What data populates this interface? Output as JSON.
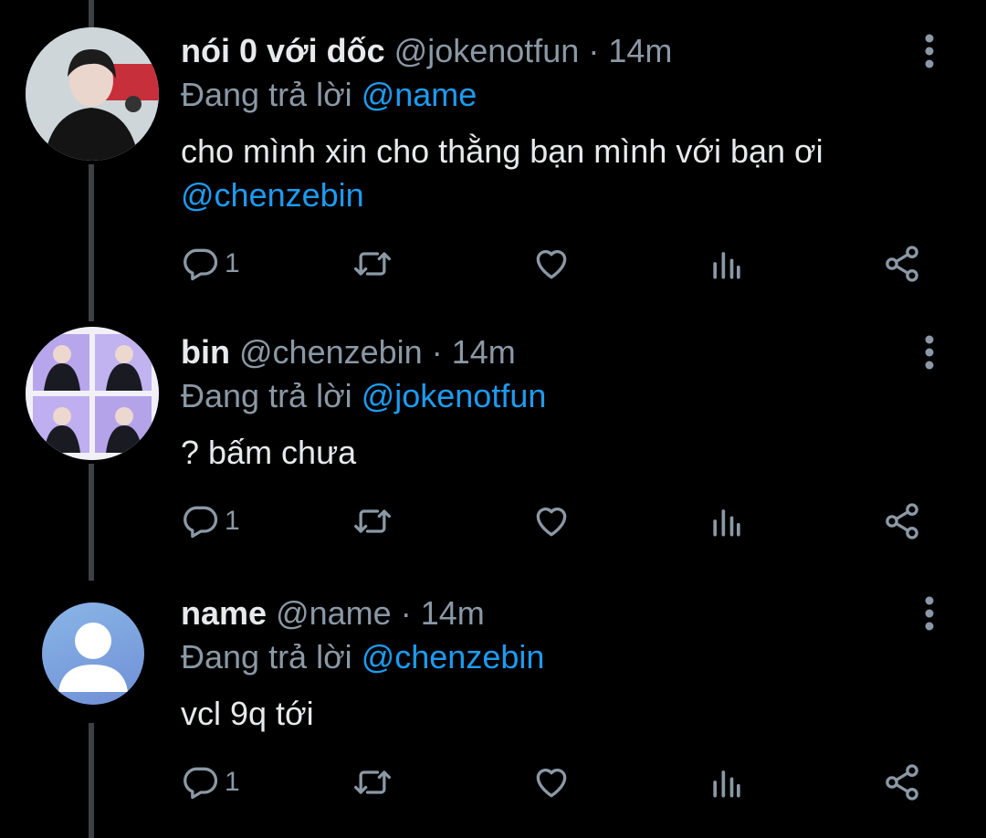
{
  "tweets": [
    {
      "display_name": "nói 0 với dốc",
      "handle": "@jokenotfun",
      "separator": "·",
      "time": "14m",
      "reply_label": "Đang trả lời",
      "reply_to": "@name",
      "text_line1": "cho mình xin cho thằng bạn mình với bạn ơi",
      "text_mention": "@chenzebin",
      "reply_count": "1",
      "avatar": "photo-avatar"
    },
    {
      "display_name": "bin",
      "handle": "@chenzebin",
      "separator": "·",
      "time": "14m",
      "reply_label": "Đang trả lời",
      "reply_to": "@jokenotfun",
      "text_line1": "? bấm chưa",
      "reply_count": "1",
      "avatar": "photo-grid-avatar"
    },
    {
      "display_name": "name",
      "handle": "@name",
      "separator": "·",
      "time": "14m",
      "reply_label": "Đang trả lời",
      "reply_to": "@chenzebin",
      "text_line1": "vcl 9q tới",
      "reply_count": "1",
      "avatar": "default-avatar"
    }
  ],
  "icons": {
    "more": "more-vertical-icon",
    "reply": "reply-icon",
    "retweet": "retweet-icon",
    "like": "heart-icon",
    "views": "views-icon",
    "share": "share-icon"
  },
  "colors": {
    "background": "#000000",
    "text": "#e7e9ea",
    "secondary": "#8b98a5",
    "mention": "#1d9bf0",
    "thread_line": "#3e4144"
  }
}
